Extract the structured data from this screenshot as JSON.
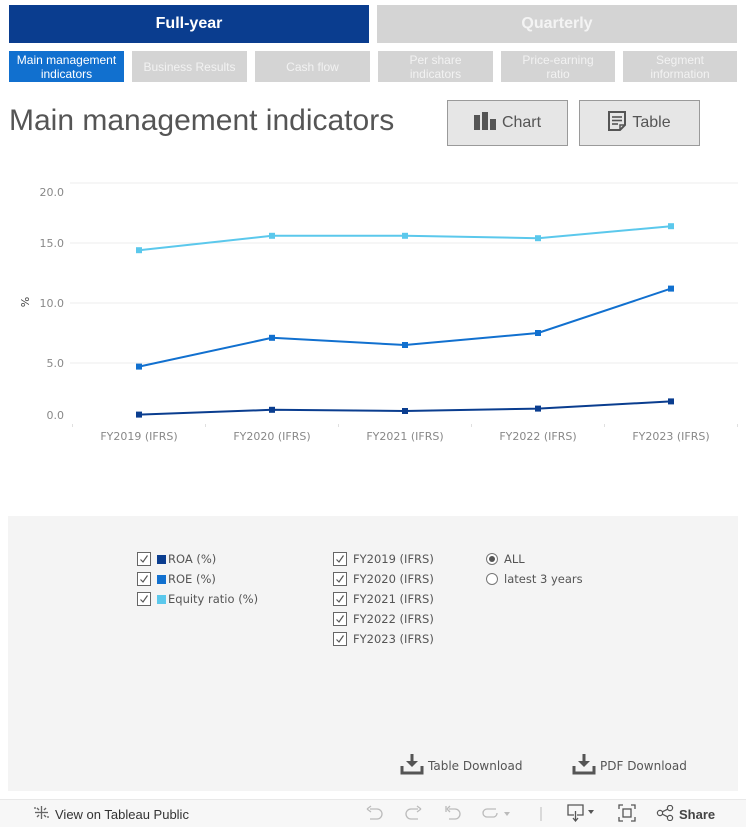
{
  "nav": {
    "top_tabs": [
      {
        "label": "Full-year",
        "active": true
      },
      {
        "label": "Quarterly",
        "active": false
      }
    ],
    "sub_tabs": [
      {
        "label": "Main management indicators",
        "active": true
      },
      {
        "label": "Business Results",
        "active": false
      },
      {
        "label": "Cash flow",
        "active": false
      },
      {
        "label": "Per share indicators",
        "active": false
      },
      {
        "label": "Price-earning ratio",
        "active": false
      },
      {
        "label": "Segment information",
        "active": false
      }
    ]
  },
  "header": {
    "title": "Main management indicators",
    "chart_button": "Chart",
    "table_button": "Table"
  },
  "colors": {
    "brand_dark": "#0a3d8f",
    "active_subtab": "#1170cf",
    "roa": "#0a3d8f",
    "roe": "#1170cf",
    "equity": "#5bc8ec"
  },
  "chart_data": {
    "type": "line",
    "title": "",
    "xlabel": "",
    "ylabel": "%",
    "categories": [
      "FY2019 (IFRS)",
      "FY2020 (IFRS)",
      "FY2021 (IFRS)",
      "FY2022 (IFRS)",
      "FY2023 (IFRS)"
    ],
    "yticks": [
      "20.0",
      "15.0",
      "10.0",
      "5.0",
      "0.0"
    ],
    "ytick_values": [
      20,
      15,
      10,
      5,
      0
    ],
    "ylim": [
      -0.7,
      20
    ],
    "grid": true,
    "markers": "square",
    "series": [
      {
        "name": "ROA (%)",
        "color": "#0a3d8f",
        "values": [
          0.7,
          1.1,
          1.0,
          1.2,
          1.8
        ]
      },
      {
        "name": "ROE (%)",
        "color": "#1170cf",
        "values": [
          4.7,
          7.1,
          6.5,
          7.5,
          11.2
        ]
      },
      {
        "name": "Equity ratio (%)",
        "color": "#5bc8ec",
        "values": [
          14.4,
          15.6,
          15.6,
          15.4,
          16.4
        ]
      }
    ]
  },
  "filters": {
    "measures": [
      {
        "label": "ROA (%)",
        "checked": true,
        "color": "#0a3d8f"
      },
      {
        "label": "ROE (%)",
        "checked": true,
        "color": "#1170cf"
      },
      {
        "label": "Equity ratio (%)",
        "checked": true,
        "color": "#5bc8ec"
      }
    ],
    "years": [
      {
        "label": "FY2019 (IFRS)",
        "checked": true
      },
      {
        "label": "FY2020 (IFRS)",
        "checked": true
      },
      {
        "label": "FY2021 (IFRS)",
        "checked": true
      },
      {
        "label": "FY2022 (IFRS)",
        "checked": true
      },
      {
        "label": "FY2023 (IFRS)",
        "checked": true
      }
    ],
    "period": [
      {
        "label": "ALL",
        "selected": true
      },
      {
        "label": "latest 3 years",
        "selected": false
      }
    ],
    "table_download": "Table Download",
    "pdf_download": "PDF Download"
  },
  "footer": {
    "view_on": "View on Tableau Public",
    "share": "Share"
  }
}
